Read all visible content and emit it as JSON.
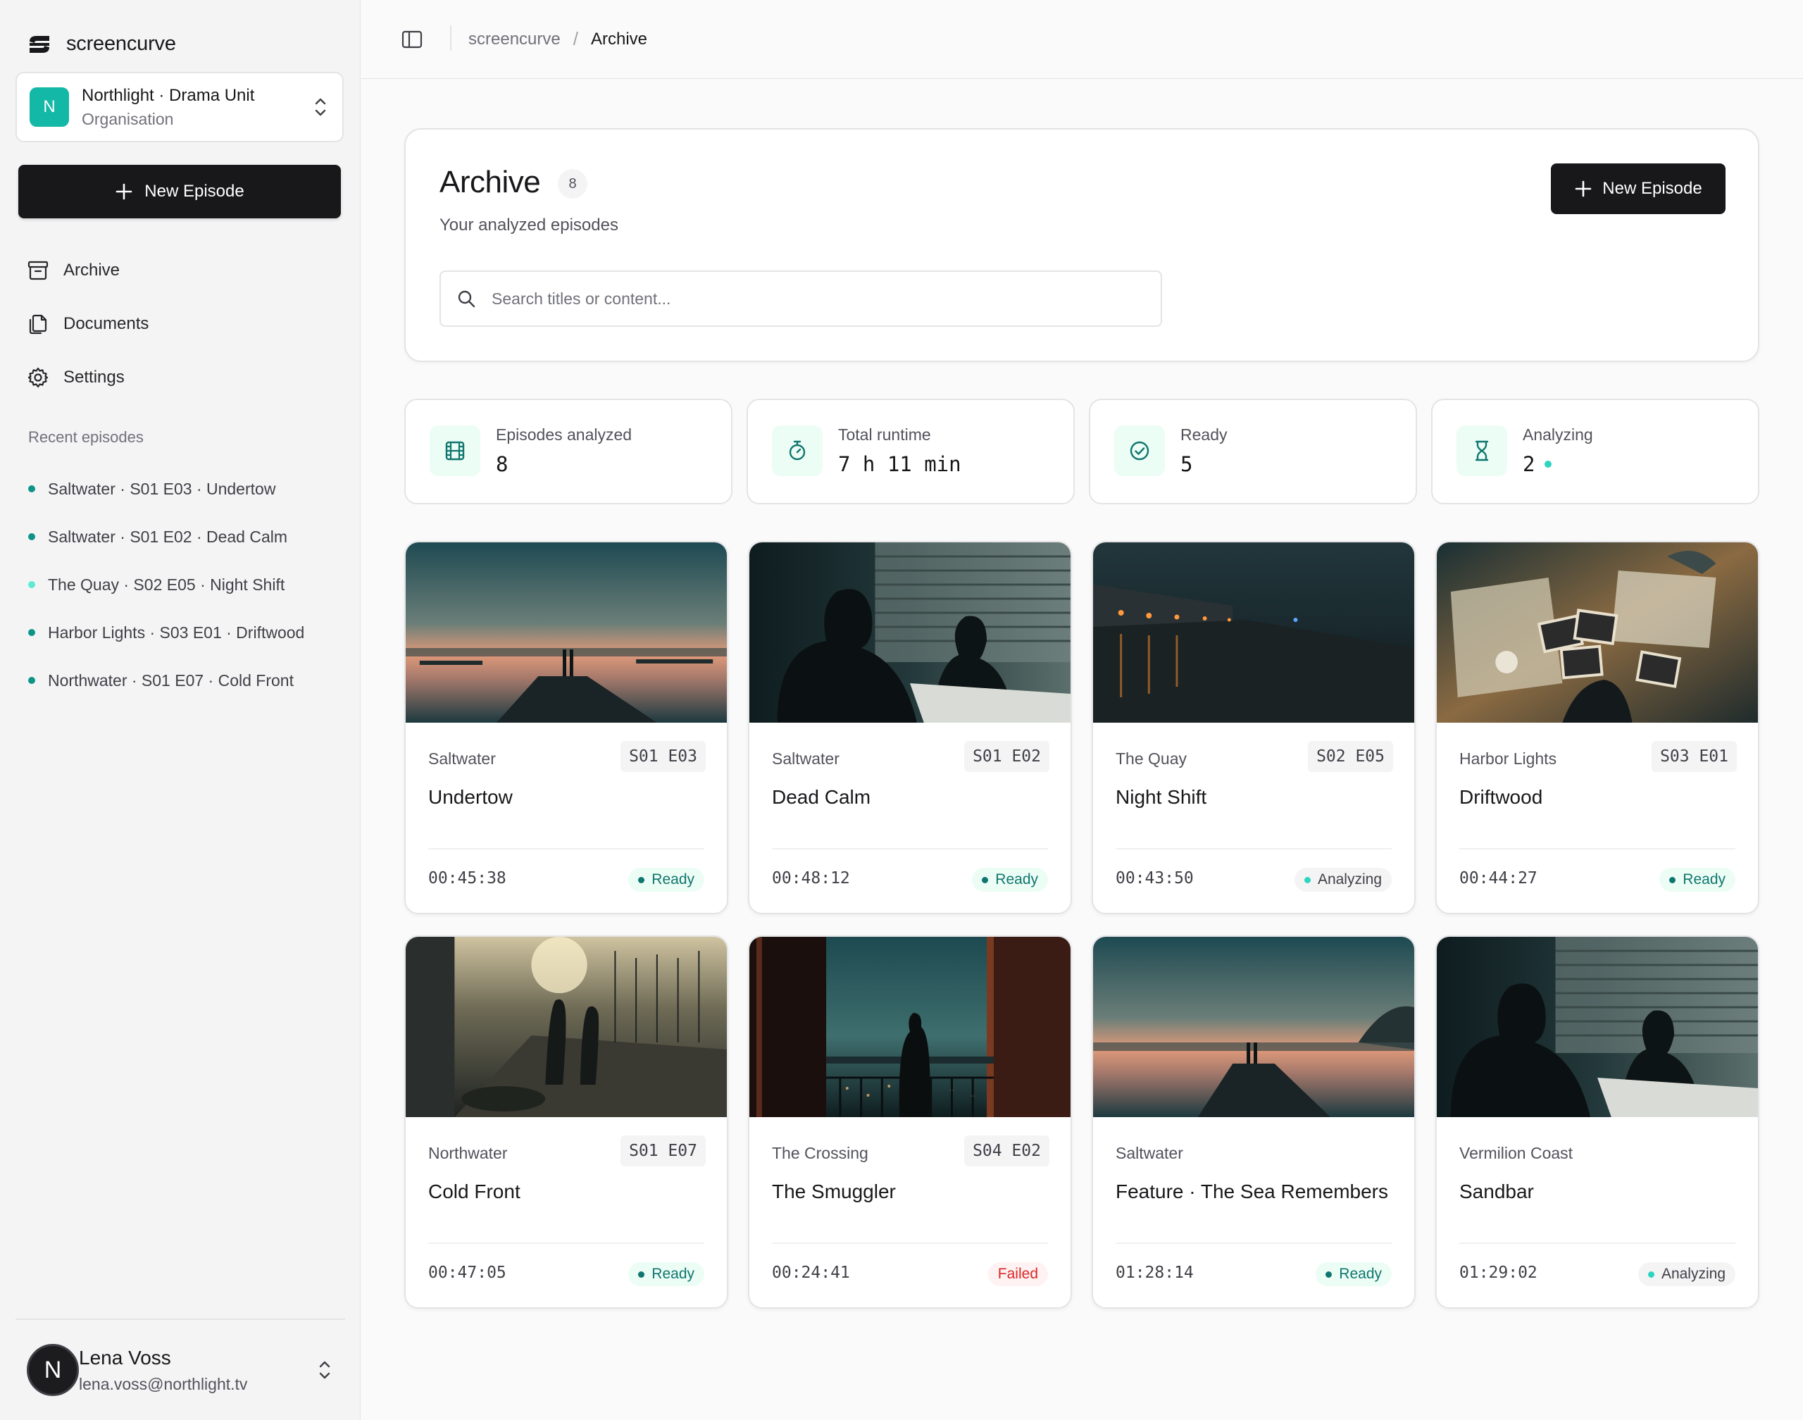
{
  "brand": {
    "name": "screencurve"
  },
  "org": {
    "initial": "N",
    "name": "Northlight · Drama Unit",
    "type": "Organisation"
  },
  "sidebar": {
    "new_episode_label": "New Episode",
    "nav": [
      {
        "label": "Archive",
        "icon": "archive-icon"
      },
      {
        "label": "Documents",
        "icon": "documents-icon"
      },
      {
        "label": "Settings",
        "icon": "gear-icon"
      }
    ],
    "recent_heading": "Recent episodes",
    "recent": [
      {
        "label": "Saltwater · S01 E03 · Undertow",
        "status": "ready"
      },
      {
        "label": "Saltwater · S01 E02 · Dead Calm",
        "status": "ready"
      },
      {
        "label": "The Quay · S02 E05 · Night Shift",
        "status": "analyzing"
      },
      {
        "label": "Harbor Lights · S03 E01 · Driftwood",
        "status": "ready"
      },
      {
        "label": "Northwater · S01 E07 · Cold Front",
        "status": "ready"
      }
    ]
  },
  "user": {
    "initial": "N",
    "name": "Lena Voss",
    "email": "lena.voss@northlight.tv"
  },
  "breadcrumb": {
    "root": "screencurve",
    "sep": "/",
    "current": "Archive"
  },
  "header": {
    "title": "Archive",
    "count": "8",
    "subtitle": "Your analyzed episodes",
    "new_episode_label": "New Episode",
    "search_placeholder": "Search titles or content..."
  },
  "stats": [
    {
      "label": "Episodes analyzed",
      "value": "8",
      "icon": "film-icon"
    },
    {
      "label": "Total runtime",
      "value": "7 h 11 min",
      "icon": "stopwatch-icon"
    },
    {
      "label": "Ready",
      "value": "5",
      "icon": "check-circle-icon"
    },
    {
      "label": "Analyzing",
      "value": "2",
      "icon": "hourglass-icon"
    }
  ],
  "colors": {
    "accent": "#14b8a6",
    "ready_text": "#0f766e",
    "ready_bg": "#ecfdf5",
    "failed_text": "#dc2626",
    "failed_bg": "#fef2f2",
    "analyzing_dot": "#2dd4bf",
    "primary_button": "#18181b"
  },
  "episodes": [
    {
      "series": "Saltwater",
      "code": "S01 E03",
      "title": "Undertow",
      "duration": "00:45:38",
      "status": "Ready",
      "status_key": "ready",
      "thumb": "sunset-pier"
    },
    {
      "series": "Saltwater",
      "code": "S01 E02",
      "title": "Dead Calm",
      "duration": "00:48:12",
      "status": "Ready",
      "status_key": "ready",
      "thumb": "window-silhouettes"
    },
    {
      "series": "The Quay",
      "code": "S02 E05",
      "title": "Night Shift",
      "duration": "00:43:50",
      "status": "Analyzing",
      "status_key": "analyzing",
      "thumb": "night-quay"
    },
    {
      "series": "Harbor Lights",
      "code": "S03 E01",
      "title": "Driftwood",
      "duration": "00:44:27",
      "status": "Ready",
      "status_key": "ready",
      "thumb": "desk-photos"
    },
    {
      "series": "Northwater",
      "code": "S01 E07",
      "title": "Cold Front",
      "duration": "00:47:05",
      "status": "Ready",
      "status_key": "ready",
      "thumb": "boat-deck"
    },
    {
      "series": "The Crossing",
      "code": "S04 E02",
      "title": "The Smuggler",
      "duration": "00:24:41",
      "status": "Failed",
      "status_key": "failed",
      "thumb": "balcony-woman"
    },
    {
      "series": "Saltwater",
      "code": "",
      "title": "Feature · The Sea Remembers",
      "duration": "01:28:14",
      "status": "Ready",
      "status_key": "ready",
      "thumb": "sunset-pier"
    },
    {
      "series": "Vermilion Coast",
      "code": "",
      "title": "Sandbar",
      "duration": "01:29:02",
      "status": "Analyzing",
      "status_key": "analyzing",
      "thumb": "window-silhouettes"
    }
  ]
}
